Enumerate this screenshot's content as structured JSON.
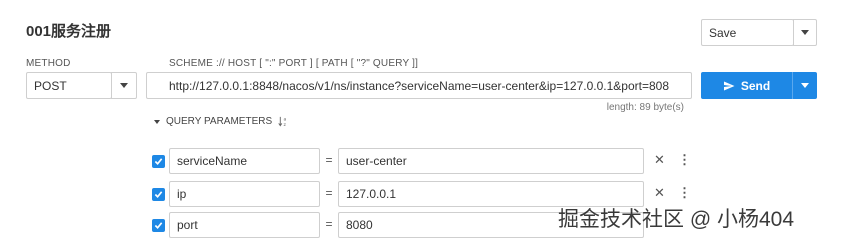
{
  "title": "001服务注册",
  "save": {
    "label": "Save"
  },
  "method": {
    "label": "METHOD",
    "value": "POST"
  },
  "url": {
    "label": "SCHEME :// HOST [ \":\" PORT ] [ PATH [ \"?\" QUERY ]]",
    "value": "http://127.0.0.1:8848/nacos/v1/ns/instance?serviceName=user-center&ip=127.0.0.1&port=808",
    "length": "length: 89 byte(s)"
  },
  "send": {
    "label": "Send"
  },
  "query": {
    "header": "QUERY PARAMETERS",
    "params": [
      {
        "key": "serviceName",
        "value": "user-center",
        "checked": true
      },
      {
        "key": "ip",
        "value": "127.0.0.1",
        "checked": true
      },
      {
        "key": "port",
        "value": "8080",
        "checked": true
      }
    ]
  },
  "watermark": "掘金技术社区 @ 小杨404",
  "colors": {
    "accent": "#1e88e5"
  }
}
